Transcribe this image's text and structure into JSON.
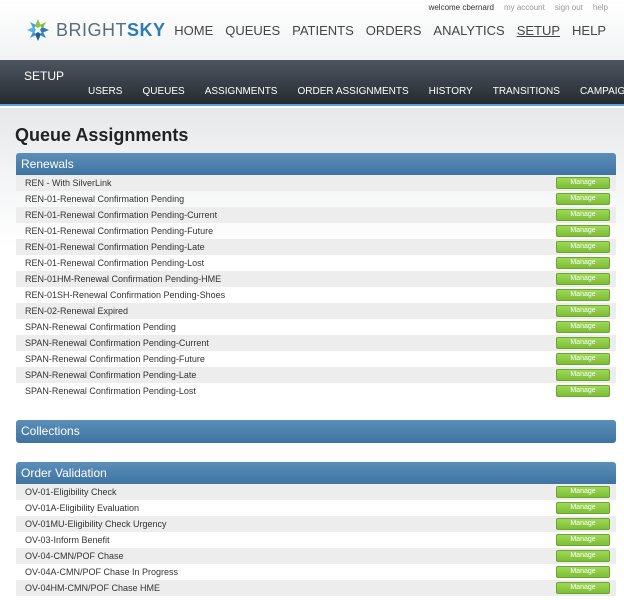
{
  "brand": {
    "word1": "BRIGHT",
    "word2": "SKY"
  },
  "userbar": {
    "welcome": "welcome cbernard",
    "links": [
      "my account",
      "sign out",
      "help"
    ]
  },
  "mainnav": [
    "HOME",
    "QUEUES",
    "PATIENTS",
    "ORDERS",
    "ANALYTICS",
    "SETUP",
    "HELP"
  ],
  "setup": {
    "title": "SETUP",
    "subnav": [
      "USERS",
      "QUEUES",
      "ASSIGNMENTS",
      "ORDER ASSIGNMENTS",
      "HISTORY",
      "TRANSITIONS",
      "CAMPAIGNS"
    ]
  },
  "page": {
    "title": "Queue Assignments"
  },
  "manage_label": "Manage",
  "sections": {
    "renewals": {
      "title": "Renewals",
      "rows": [
        "REN - With SilverLink",
        "REN-01-Renewal Confirmation Pending",
        "REN-01-Renewal Confirmation Pending-Current",
        "REN-01-Renewal Confirmation Pending-Future",
        "REN-01-Renewal Confirmation Pending-Late",
        "REN-01-Renewal Confirmation Pending-Lost",
        "REN-01HM-Renewal Confirmation Pending-HME",
        "REN-01SH-Renewal Confirmation Pending-Shoes",
        "REN-02-Renewal Expired",
        "SPAN-Renewal Confirmation Pending",
        "SPAN-Renewal Confirmation Pending-Current",
        "SPAN-Renewal Confirmation Pending-Future",
        "SPAN-Renewal Confirmation Pending-Late",
        "SPAN-Renewal Confirmation Pending-Lost"
      ]
    },
    "collections": {
      "title": "Collections"
    },
    "order_validation": {
      "title": "Order Validation",
      "rows": [
        "OV-01-Eligibility Check",
        "OV-01A-Eligibility Evaluation",
        "OV-01MU-Eligibility Check Urgency",
        "OV-03-Inform Benefit",
        "OV-04-CMN/POF Chase",
        "OV-04A-CMN/POF Chase In Progress",
        "OV-04HM-CMN/POF Chase HME"
      ]
    }
  }
}
